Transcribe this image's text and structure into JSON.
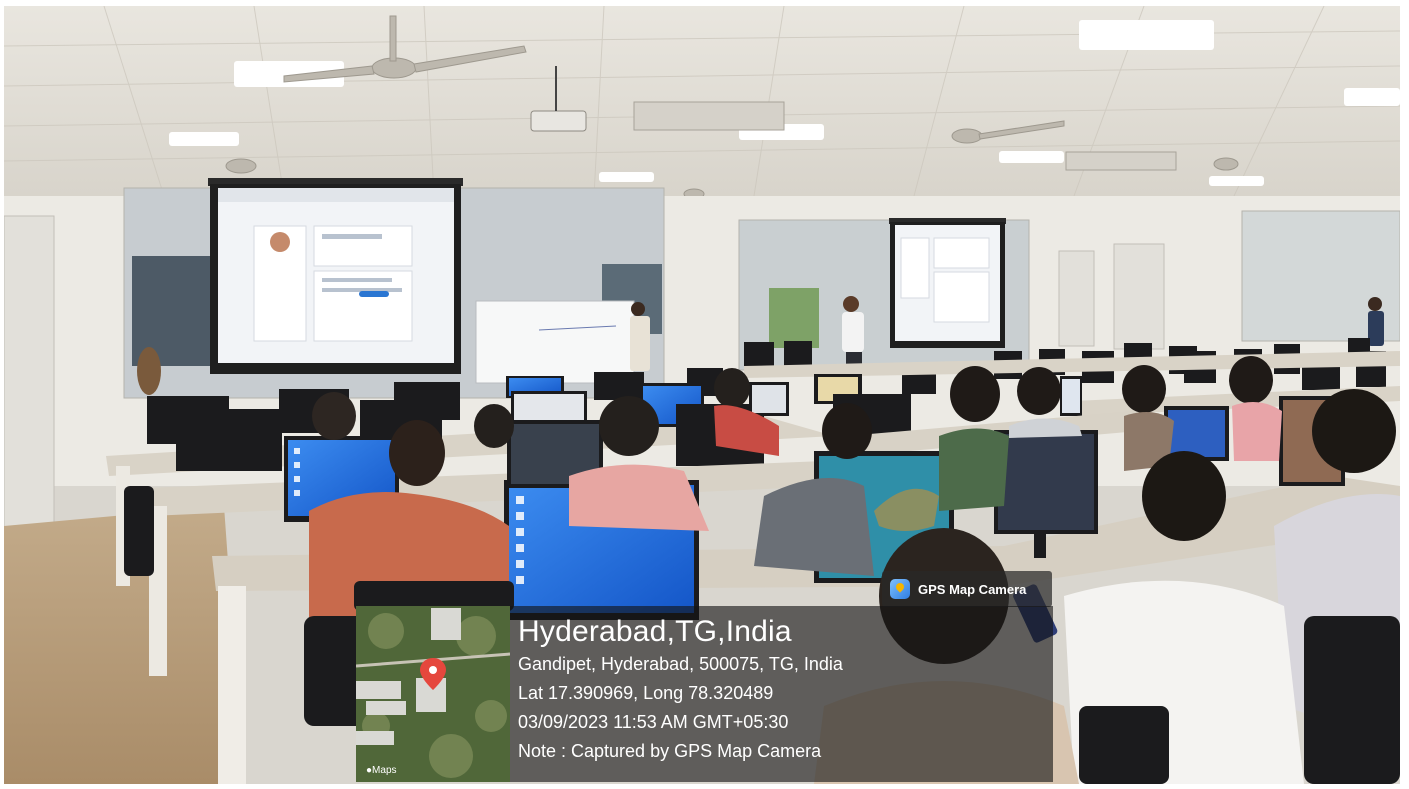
{
  "gps_badge": {
    "label": "GPS Map Camera",
    "icon": "gps-map-camera-app-icon"
  },
  "gps_map": {
    "maps_label": "Maps",
    "pin_color": "#e5473d"
  },
  "gps_info": {
    "title": "Hyderabad,TG,India",
    "address": "Gandipet, Hyderabad, 500075, TG, India",
    "coordinates": "Lat 17.390969, Long 78.320489",
    "datetime": "03/09/2023 11:53 AM GMT+05:30",
    "note": "Note : Captured by GPS Map Camera"
  },
  "colors": {
    "ceiling": "#ece9e2",
    "floor": "#b59a78",
    "monitor_screen_blue": "#1a73e8",
    "desk": "#d8d2c6"
  }
}
